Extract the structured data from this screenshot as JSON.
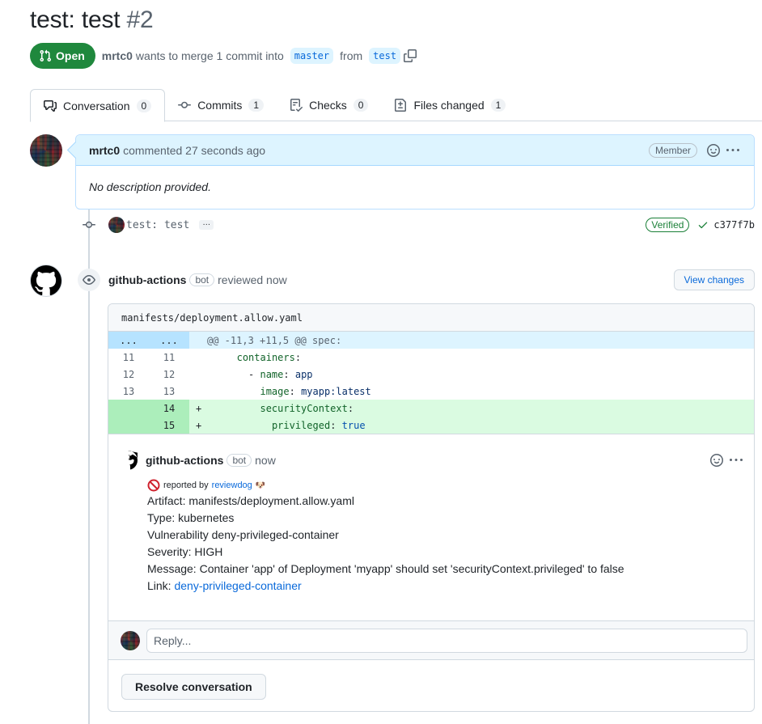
{
  "pr": {
    "title": "test: test",
    "number": "#2",
    "state": "Open",
    "author": "mrtc0",
    "merge_text": "wants to merge 1 commit into",
    "base_branch": "master",
    "from_text": "from",
    "head_branch": "test"
  },
  "tabs": [
    {
      "label": "Conversation",
      "count": "0",
      "icon": "comment-discussion-icon"
    },
    {
      "label": "Commits",
      "count": "1",
      "icon": "git-commit-icon"
    },
    {
      "label": "Checks",
      "count": "0",
      "icon": "checklist-icon"
    },
    {
      "label": "Files changed",
      "count": "1",
      "icon": "file-diff-icon"
    }
  ],
  "comment": {
    "author": "mrtc0",
    "action": "commented 27 seconds ago",
    "role": "Member",
    "body": "No description provided."
  },
  "commit": {
    "message": "test: test",
    "ellipsis": "…",
    "verified": "Verified",
    "sha": "c377f7b"
  },
  "review": {
    "author": "github-actions",
    "bot_label": "bot",
    "action": "reviewed now",
    "view_changes": "View changes"
  },
  "diff": {
    "file": "manifests/deployment.allow.yaml",
    "hunk_marker": "...",
    "hunk": "@@ -11,3 +11,5 @@ spec:",
    "lines": [
      {
        "old": "11",
        "new": "11",
        "sign": " ",
        "indent": "      ",
        "key": "containers",
        "sep": ":",
        "val": ""
      },
      {
        "old": "12",
        "new": "12",
        "sign": " ",
        "indent": "        - ",
        "key": "name",
        "sep": ": ",
        "val": "app"
      },
      {
        "old": "13",
        "new": "13",
        "sign": " ",
        "indent": "          ",
        "key": "image",
        "sep": ": ",
        "val": "myapp:latest"
      },
      {
        "old": "",
        "new": "14",
        "sign": "+",
        "indent": "          ",
        "key": "securityContext",
        "sep": ":",
        "val": ""
      },
      {
        "old": "",
        "new": "15",
        "sign": "+",
        "indent": "            ",
        "key": "privileged",
        "sep": ": ",
        "val": "true"
      }
    ]
  },
  "thread": {
    "author": "github-actions",
    "bot_label": "bot",
    "time": "now",
    "reported_prefix": "reported by",
    "reported_by": "reviewdog",
    "dog_emoji": "🐶",
    "lines": [
      "Artifact: manifests/deployment.allow.yaml",
      "Type: kubernetes",
      "Vulnerability deny-privileged-container",
      "Severity: HIGH",
      "Message: Container 'app' of Deployment 'myapp' should set 'securityContext.privileged' to false"
    ],
    "link_prefix": "Link:",
    "link_text": "deny-privileged-container",
    "reply_placeholder": "Reply...",
    "resolve": "Resolve conversation"
  }
}
